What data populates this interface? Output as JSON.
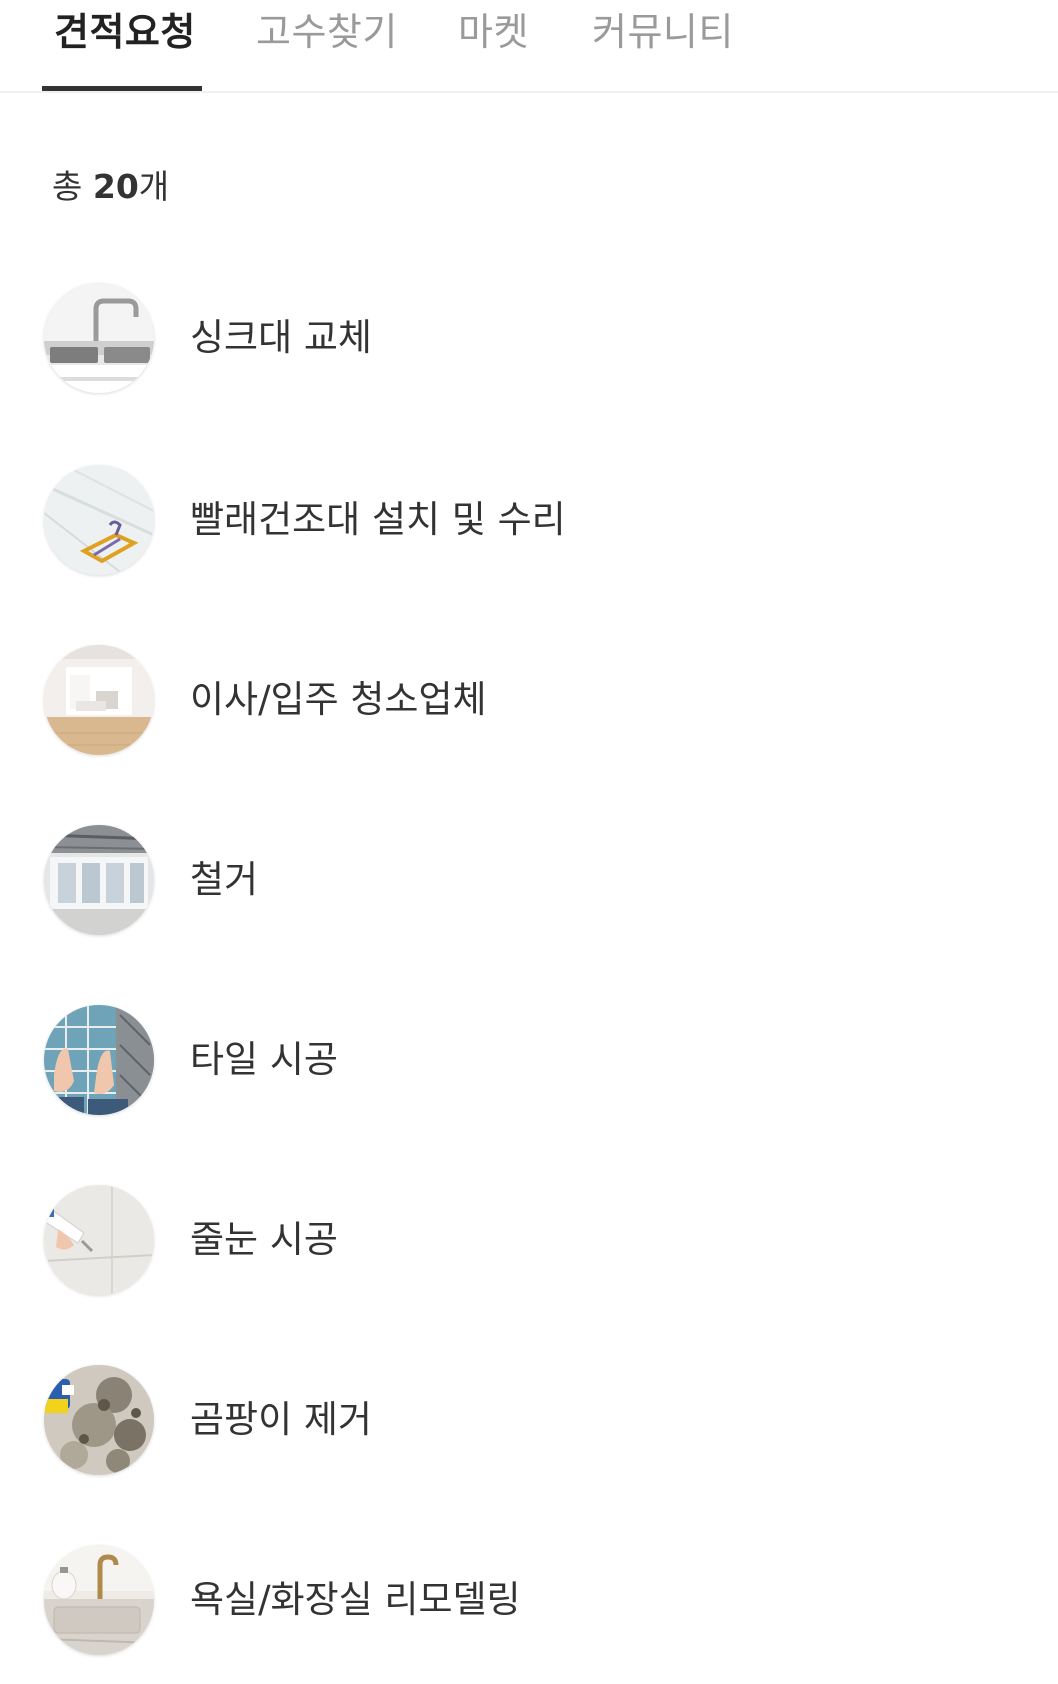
{
  "tabs": [
    {
      "label": "견적요청",
      "active": true
    },
    {
      "label": "고수찾기",
      "active": false
    },
    {
      "label": "마켓",
      "active": false
    },
    {
      "label": "커뮤니티",
      "active": false
    }
  ],
  "summary": {
    "prefix": "총 ",
    "count": "20",
    "suffix": "개"
  },
  "services": [
    {
      "label": "싱크대 교체",
      "image": "sink-photo"
    },
    {
      "label": "빨래건조대 설치 및 수리",
      "image": "drying-rack-photo"
    },
    {
      "label": "이사/입주 청소업체",
      "image": "empty-room-photo"
    },
    {
      "label": "철거",
      "image": "demolition-photo"
    },
    {
      "label": "타일 시공",
      "image": "tile-photo"
    },
    {
      "label": "줄눈 시공",
      "image": "grout-photo"
    },
    {
      "label": "곰팡이 제거",
      "image": "mold-photo"
    },
    {
      "label": "욕실/화장실 리모델링",
      "image": "bathroom-photo"
    }
  ]
}
